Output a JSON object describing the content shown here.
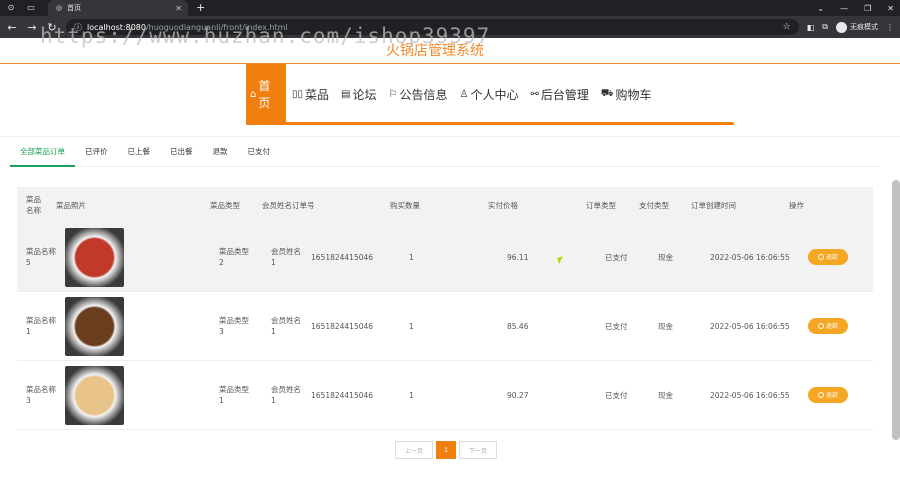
{
  "browser": {
    "tab_title": "首页",
    "url_host": "localhost:8080",
    "url_path": "/huoguodianguanli/front/index.html",
    "incognito_label": "无痕模式"
  },
  "watermark": "https://www.huzhan.com/ishop39397",
  "site": {
    "title": "火锅店管理系统"
  },
  "nav": [
    {
      "icon": "home-icon",
      "label": "首页"
    },
    {
      "icon": "grid-icon",
      "label": "菜品"
    },
    {
      "icon": "forum-icon",
      "label": "论坛"
    },
    {
      "icon": "flag-icon",
      "label": "公告信息"
    },
    {
      "icon": "user-icon",
      "label": "个人中心"
    },
    {
      "icon": "link-icon",
      "label": "后台管理"
    },
    {
      "icon": "cart-icon",
      "label": "购物车"
    }
  ],
  "order_tabs": [
    "全部菜品订单",
    "已评价",
    "已上餐",
    "已出餐",
    "退款",
    "已支付"
  ],
  "table": {
    "headers": [
      "菜品名称",
      "菜品照片",
      "菜品类型",
      "会员姓名",
      "订单号",
      "购买数量",
      "实付价格",
      "订单类型",
      "支付类型",
      "订单创建时间",
      "操作"
    ],
    "rows": [
      {
        "name": "菜品名称5",
        "type": "菜品类型2",
        "member": "会员姓名1",
        "order_no": "1651824415046",
        "qty": "1",
        "price": "96.11",
        "order_type": "已支付",
        "pay_type": "现金",
        "created": "2022-05-06 16:06:55",
        "action": "退款",
        "img_color": "#c0392b"
      },
      {
        "name": "菜品名称1",
        "type": "菜品类型3",
        "member": "会员姓名1",
        "order_no": "1651824415046",
        "qty": "1",
        "price": "85.46",
        "order_type": "已支付",
        "pay_type": "现金",
        "created": "2022-05-06 16:06:55",
        "action": "退款",
        "img_color": "#6b3e1f"
      },
      {
        "name": "菜品名称3",
        "type": "菜品类型1",
        "member": "会员姓名1",
        "order_no": "1651824415046",
        "qty": "1",
        "price": "90.27",
        "order_type": "已支付",
        "pay_type": "现金",
        "created": "2022-05-06 16:06:55",
        "action": "退款",
        "img_color": "#e8c48a"
      }
    ]
  },
  "pager": {
    "prev": "上一页",
    "current": "1",
    "next": "下一页"
  },
  "colors": {
    "accent": "#f07f0f",
    "tab_active": "#18a058",
    "refund": "#f5a623"
  }
}
